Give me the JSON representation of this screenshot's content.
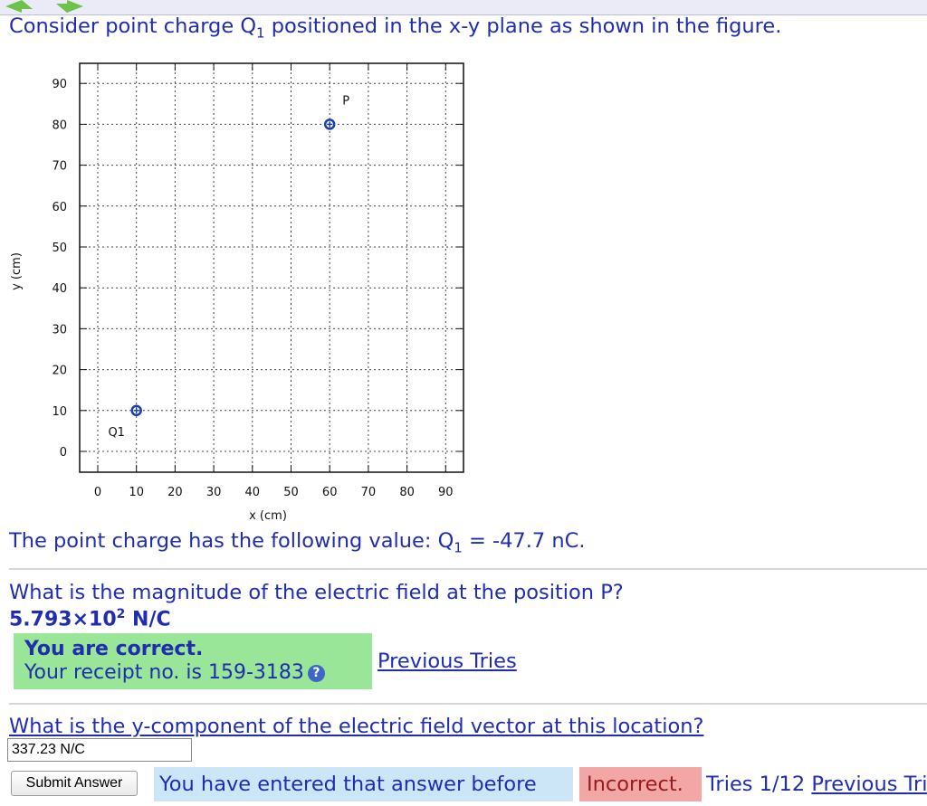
{
  "problem": {
    "intro": "Consider point charge Q",
    "intro_sub": "1",
    "intro_rest": " positioned in the x-y plane as shown in the figure.",
    "charge_text": "The point charge has the following value: Q",
    "charge_sub": "1",
    "charge_rest": " = -47.7 nC."
  },
  "part1": {
    "question": "What is the magnitude of the electric field at the position P?",
    "answer_mantissa": "5.793×10",
    "answer_exp": "2",
    "answer_unit": " N/C",
    "feedback_title": "You are correct.",
    "receipt": "Your receipt no. is 159-3183",
    "help_icon_glyph": "?",
    "previous_tries_label": "Previous Tries"
  },
  "part2": {
    "question": "What is the y-component of the electric field vector at this location?",
    "input_value": "337.23 N/C",
    "submit_label": "Submit Answer",
    "status_before": "You have entered that answer before",
    "status_incorrect": "Incorrect.",
    "tries": "Tries 1/12",
    "previous_label": "Previous Tries"
  },
  "icons": {
    "nav_left": "arrow-left-icon",
    "nav_right": "arrow-right-icon",
    "help": "help-icon"
  },
  "colors": {
    "text": "#1f2dae",
    "correct_bg": "#99e699",
    "before_bg": "#cce6f7",
    "incorrect_bg": "#f2a6a6",
    "marker": "#1a3fa8"
  },
  "chart_data": {
    "type": "scatter",
    "xlabel": "x (cm)",
    "ylabel": "y (cm)",
    "xlim": [
      0,
      90
    ],
    "ylim": [
      0,
      90
    ],
    "xticks": [
      0,
      10,
      20,
      30,
      40,
      50,
      60,
      70,
      80,
      90
    ],
    "yticks": [
      0,
      10,
      20,
      30,
      40,
      50,
      60,
      70,
      80,
      90
    ],
    "grid": true,
    "points": [
      {
        "label": "Q1",
        "x": 10,
        "y": 10
      },
      {
        "label": "P",
        "x": 60,
        "y": 80
      }
    ]
  }
}
